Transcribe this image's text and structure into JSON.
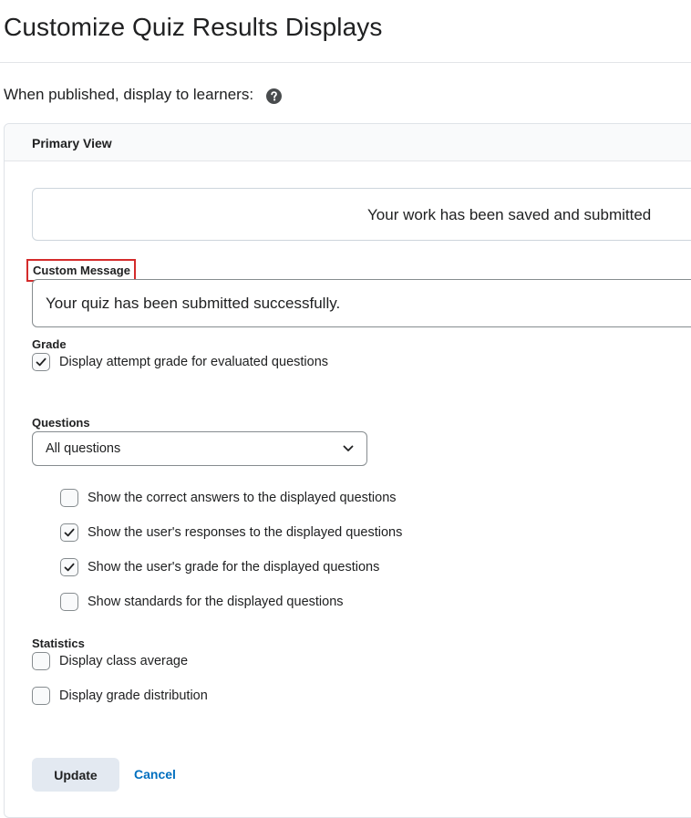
{
  "page": {
    "title": "Customize Quiz Results Displays"
  },
  "publish": {
    "label": "When published, display to learners:",
    "help_icon": "question-circle-icon"
  },
  "panel": {
    "header": "Primary View",
    "preview_message": "Your work has been saved and submitted"
  },
  "custom_message": {
    "label": "Custom Message",
    "value": "Your quiz has been submitted successfully.",
    "highlight_color": "#d42b2b"
  },
  "grade": {
    "label": "Grade",
    "options": [
      {
        "label": "Display attempt grade for evaluated questions",
        "checked": true
      }
    ]
  },
  "questions": {
    "label": "Questions",
    "selected": "All questions",
    "options": [
      {
        "label": "Show the correct answers to the displayed questions",
        "checked": false
      },
      {
        "label": "Show the user's responses to the displayed questions",
        "checked": true
      },
      {
        "label": "Show the user's grade for the displayed questions",
        "checked": true
      },
      {
        "label": "Show standards for the displayed questions",
        "checked": false
      }
    ]
  },
  "statistics": {
    "label": "Statistics",
    "options": [
      {
        "label": "Display class average",
        "checked": false
      },
      {
        "label": "Display grade distribution",
        "checked": false
      }
    ]
  },
  "actions": {
    "update_label": "Update",
    "cancel_label": "Cancel",
    "link_color": "#006fbf"
  }
}
